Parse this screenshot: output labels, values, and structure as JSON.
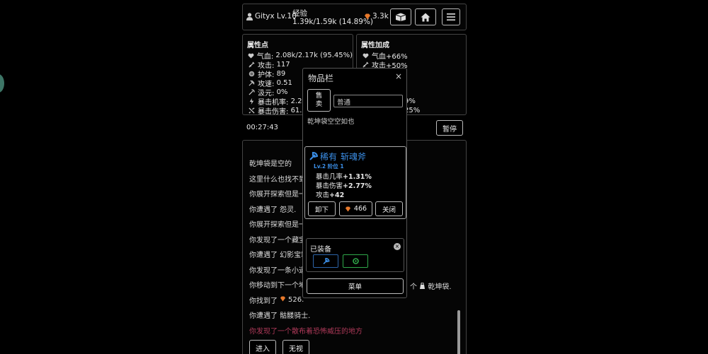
{
  "header": {
    "player_name": "Gityx Lv.10",
    "exp_label": "经验",
    "exp_value": "1.39k/1.59k (14.89%)",
    "gold": "3.3k",
    "icons": [
      "user-icon",
      "gem-icon",
      "box-icon",
      "home-icon",
      "menu-icon"
    ]
  },
  "stats_panel": {
    "title": "属性点",
    "rows": [
      {
        "icon": "heart-icon",
        "label": "气血:",
        "value": "2.08k/2.17k (95.45%)"
      },
      {
        "icon": "sword-icon",
        "label": "攻击:",
        "value": "117"
      },
      {
        "icon": "shield-icon",
        "label": "护体:",
        "value": "89"
      },
      {
        "icon": "speed-icon",
        "label": "攻速:",
        "value": "0.51"
      },
      {
        "icon": "drain-icon",
        "label": "汲元:",
        "value": "0%"
      },
      {
        "icon": "bolt-icon",
        "label": "暴击机率:",
        "value": "2.21"
      },
      {
        "icon": "crit-damage-icon",
        "label": "暴击伤害:",
        "value": "61.02"
      }
    ]
  },
  "bonus_panel": {
    "title": "属性加成",
    "rows": [
      {
        "icon": "heart-icon",
        "text": "气血+66%"
      },
      {
        "icon": "sword-icon",
        "text": "攻击+50%"
      },
      {
        "icon": "shield-icon",
        "text": "护体+"
      },
      {
        "icon": "speed-icon",
        "text": ""
      },
      {
        "icon": "drain-icon",
        "text": ""
      },
      {
        "icon": "bolt-icon",
        "text": "9%"
      },
      {
        "icon": "crit-damage-icon",
        "text": "25%"
      }
    ]
  },
  "timer": "00:27:43",
  "pause_label": "暂停",
  "log": [
    {
      "text": "乾坤袋是空的",
      "color": "#dddddd"
    },
    {
      "text": "这里什么也找不到",
      "color": "#dddddd"
    },
    {
      "text": "你展开探索但是一",
      "color": "#dddddd"
    },
    {
      "text": "你遭遇了 怨灵.",
      "color": "#dddddd"
    },
    {
      "text": "你展开探索但是一",
      "color": "#dddddd"
    },
    {
      "text": "你发现了一个藏宝",
      "color": "#dddddd"
    },
    {
      "text": "你遭遇了 幻影宝箱",
      "color": "#dddddd"
    },
    {
      "text": "你发现了一条小道",
      "color": "#dddddd"
    },
    {
      "text": "你移动到下一个地",
      "color": "#dddddd"
    },
    {
      "text": "你找到了",
      "color": "#dddddd"
    },
    {
      "text": "你遭遇了 骷髅骑士.",
      "color": "#dddddd"
    },
    {
      "text": "你发现了一个散布着恐怖威压的地方",
      "color": "#b03a5a"
    }
  ],
  "log_found_amount": "526.",
  "log_bag_tail": "个",
  "log_bag_label": "乾坤袋.",
  "enter_button": "进入",
  "ignore_button": "无视",
  "inventory": {
    "title": "物品栏",
    "close": "×",
    "sell_label": "售卖",
    "filter_value": "普通",
    "empty_message": "乾坤袋空空如也",
    "item": {
      "rarity": "稀有",
      "name": "斩魂斧",
      "rarity_color": "#3b8fe8",
      "meta": "Lv.2 阶位 1",
      "stats": [
        {
          "label": "暴击几率",
          "value": "+1.31%"
        },
        {
          "label": "暴击伤害",
          "value": "+2.77%"
        },
        {
          "label": "攻击",
          "value": "+42"
        }
      ],
      "unequip_label": "卸下",
      "price": "466",
      "close_label": "关闭"
    },
    "equipped_title": "已装备",
    "slots": [
      {
        "icon": "axe-icon",
        "color": "#3b8fe8"
      },
      {
        "icon": "ring-icon",
        "color": "#2fa84a"
      }
    ],
    "menu_label": "菜单"
  }
}
